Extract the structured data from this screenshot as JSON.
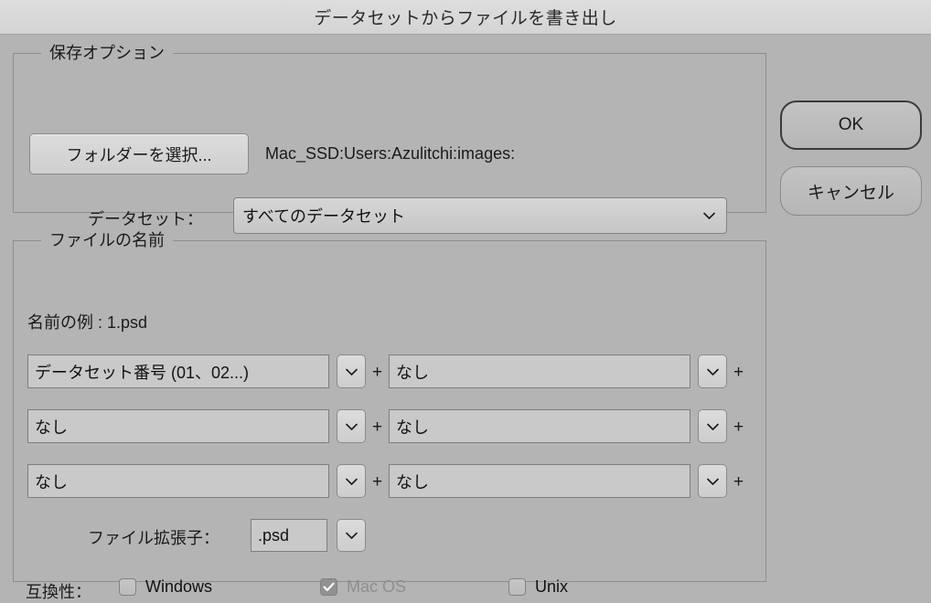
{
  "window": {
    "title": "データセットからファイルを書き出し"
  },
  "actions": {
    "ok_label": "OK",
    "cancel_label": "キャンセル"
  },
  "save_options": {
    "legend": "保存オプション",
    "choose_folder_label": "フォルダーを選択...",
    "folder_path": "Mac_SSD:Users:Azulitchi:images:",
    "dataset_label": "データセット：",
    "dataset_value": "すべてのデータセット"
  },
  "file_naming": {
    "legend": "ファイルの名前",
    "sample_label": "名前の例 : 1.psd",
    "plus_label": "+",
    "rows": [
      {
        "left_value": "データセット番号 (01、02...)",
        "right_value": "なし"
      },
      {
        "left_value": "なし",
        "right_value": "なし"
      },
      {
        "left_value": "なし",
        "right_value": "なし"
      }
    ],
    "extension_label": "ファイル拡張子：",
    "extension_value": ".psd",
    "compatibility_label": "互換性：",
    "compatibility": [
      {
        "label": "Windows",
        "checked": false,
        "disabled": false
      },
      {
        "label": "Mac OS",
        "checked": true,
        "disabled": true
      },
      {
        "label": "Unix",
        "checked": false,
        "disabled": false
      }
    ]
  },
  "icons": {
    "chevron_down": "chevron-down-icon",
    "check": "check-icon"
  },
  "colors": {
    "titlebar": "#d9d9d9",
    "dialog_background": "#b4b4b4",
    "field_background": "#c9c9c9",
    "border": "#8e8e8e",
    "text": "#1a1a1a",
    "disabled_text": "#8e8e8e"
  }
}
